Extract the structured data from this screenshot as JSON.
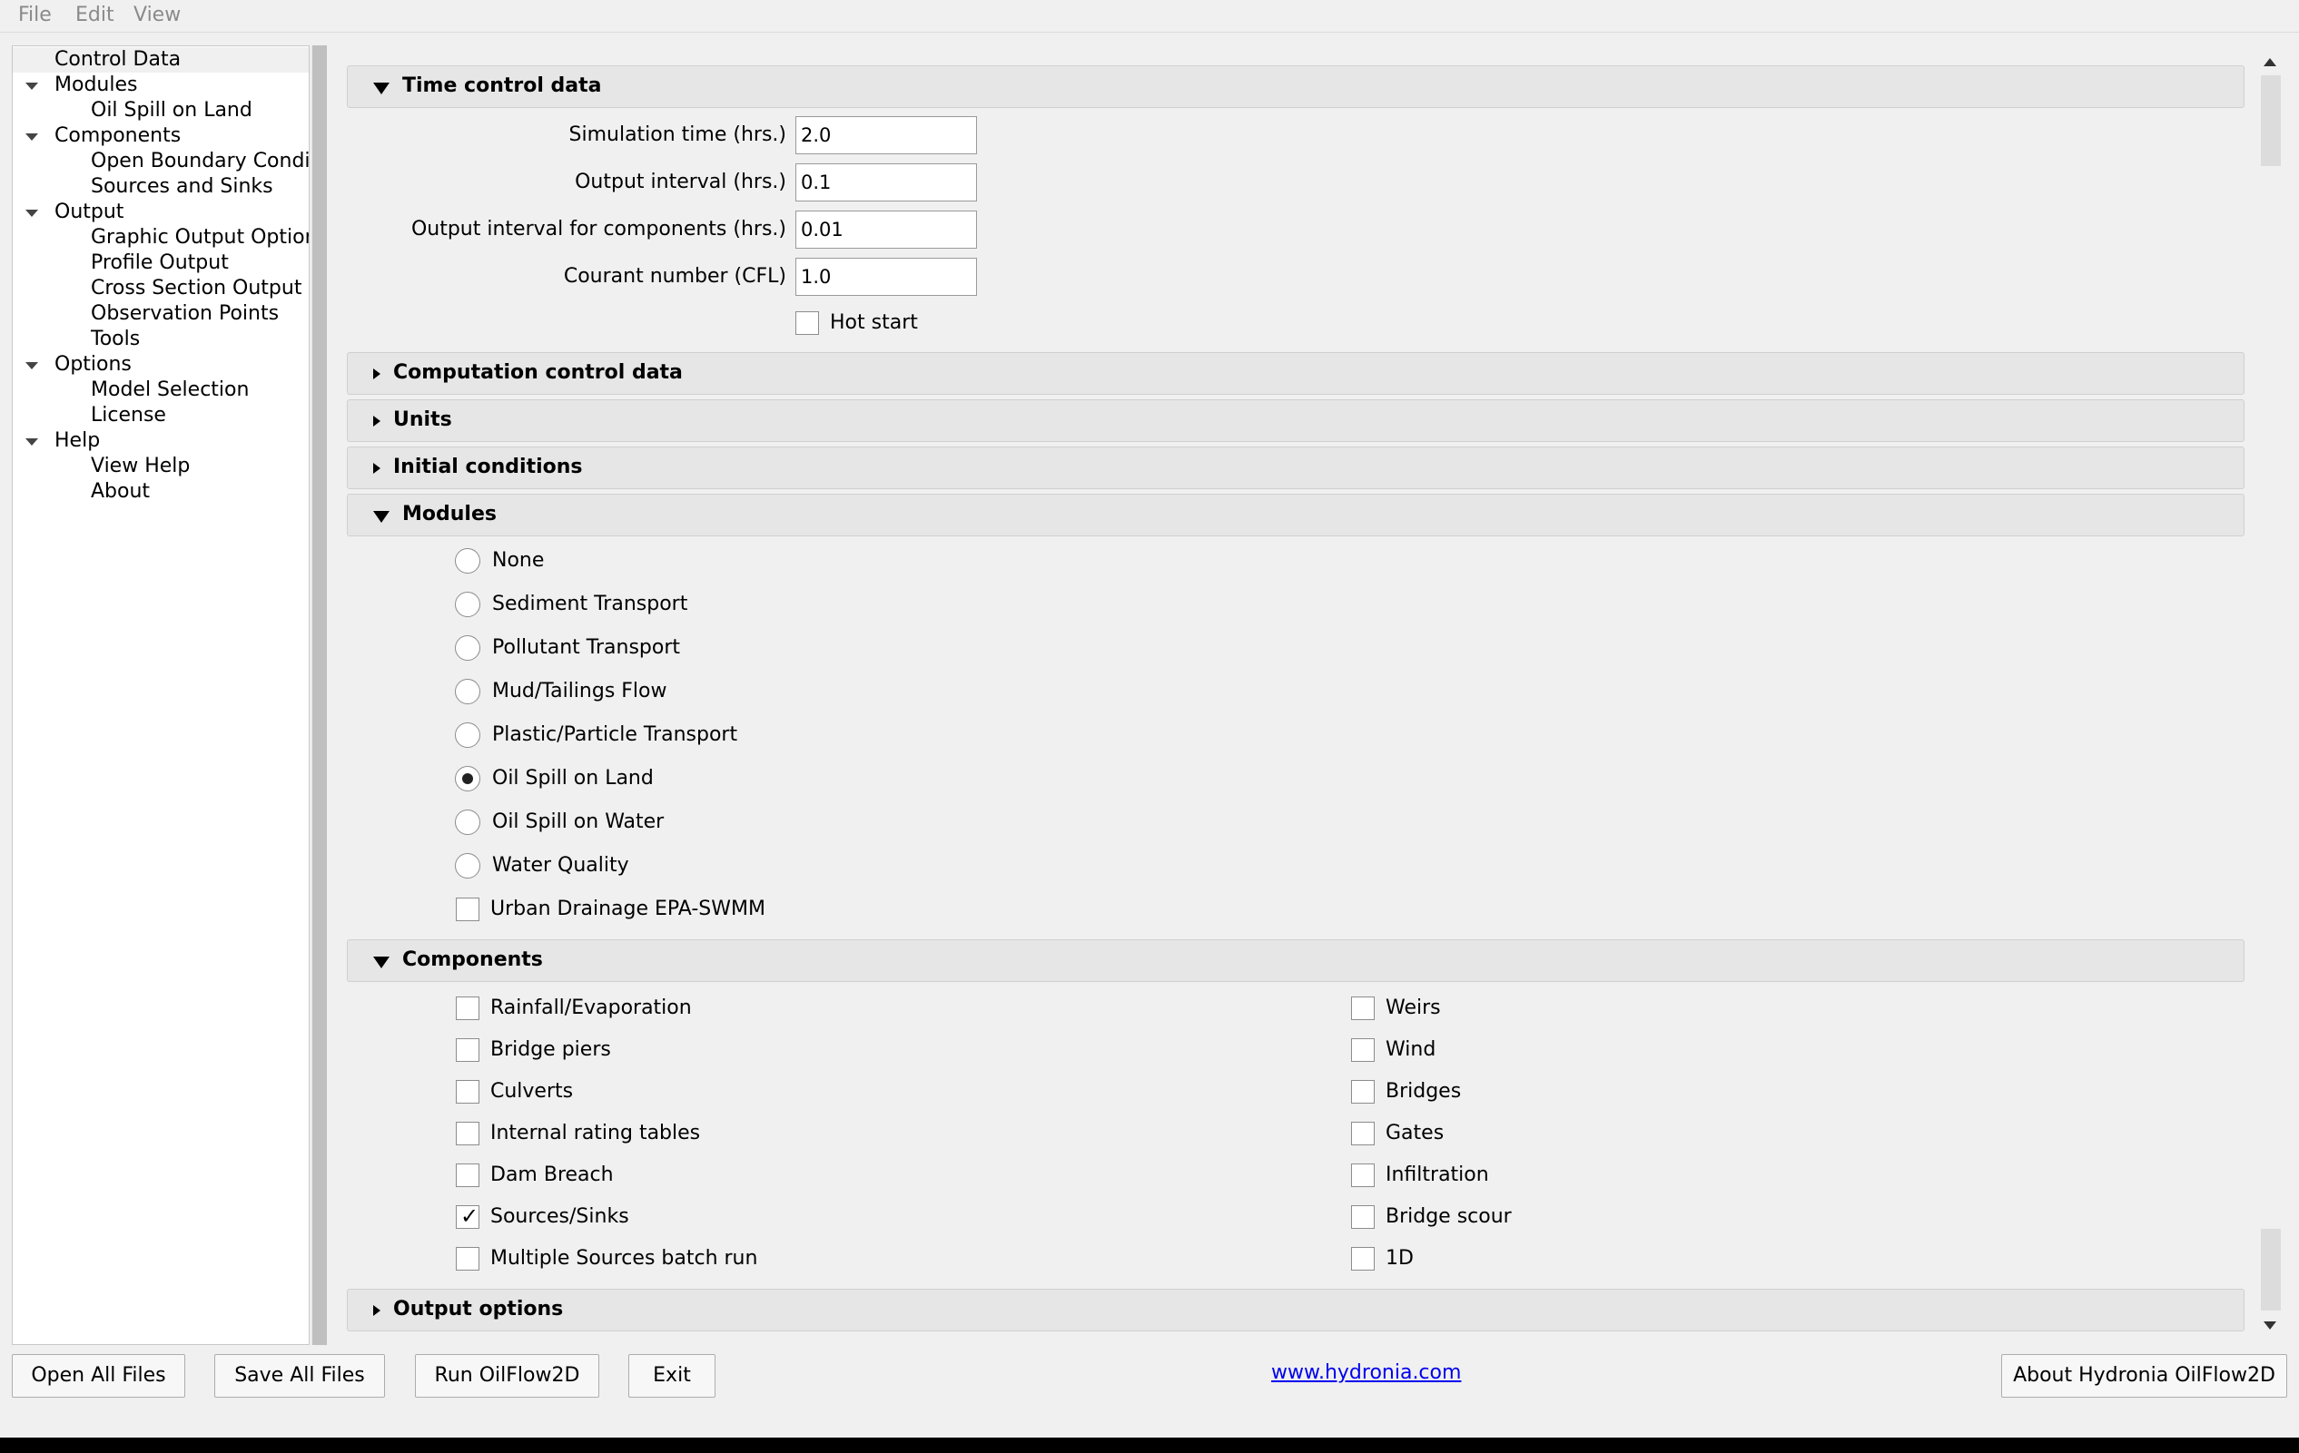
{
  "menu": {
    "file": "File",
    "edit": "Edit",
    "view": "View"
  },
  "tree": {
    "control_data": "Control Data",
    "modules": "Modules",
    "oil_spill_on_land": "Oil Spill on Land",
    "components": "Components",
    "open_boundary": "Open Boundary Condi...",
    "sources_and_sinks": "Sources and Sinks",
    "output": "Output",
    "graphic_output_options": "Graphic Output Options",
    "profile_output": "Profile Output",
    "cross_section_output": "Cross Section Output",
    "observation_points": "Observation Points",
    "tools": "Tools",
    "options": "Options",
    "model_selection": "Model Selection",
    "license": "License",
    "help": "Help",
    "view_help": "View Help",
    "about": "About"
  },
  "time_control": {
    "title": "Time control data",
    "simulation_time_label": "Simulation time (hrs.)",
    "simulation_time_value": "2.0",
    "output_interval_label": "Output interval (hrs.)",
    "output_interval_value": "0.1",
    "output_interval_components_label": "Output interval for components (hrs.)",
    "output_interval_components_value": "0.01",
    "courant_label": "Courant number (CFL)",
    "courant_value": "1.0",
    "hot_start_label": "Hot start",
    "hot_start_checked": false
  },
  "sections": {
    "computation_control": "Computation control data",
    "units": "Units",
    "initial_conditions": "Initial conditions",
    "modules": "Modules",
    "components": "Components",
    "output_options": "Output options"
  },
  "modules": {
    "options": [
      "None",
      "Sediment Transport",
      "Pollutant Transport",
      "Mud/Tailings Flow",
      "Plastic/Particle Transport",
      "Oil Spill on Land",
      "Oil Spill on Water",
      "Water Quality"
    ],
    "selected": "Oil Spill on Land",
    "urban_drainage_label": "Urban Drainage EPA-SWMM",
    "urban_drainage_checked": false
  },
  "components": {
    "left": [
      {
        "label": "Rainfall/Evaporation",
        "checked": false
      },
      {
        "label": "Bridge piers",
        "checked": false
      },
      {
        "label": "Culverts",
        "checked": false
      },
      {
        "label": "Internal rating tables",
        "checked": false
      },
      {
        "label": "Dam Breach",
        "checked": false
      },
      {
        "label": "Sources/Sinks",
        "checked": true
      },
      {
        "label": "Multiple Sources batch run",
        "checked": false
      }
    ],
    "right": [
      {
        "label": "Weirs",
        "checked": false
      },
      {
        "label": "Wind",
        "checked": false
      },
      {
        "label": "Bridges",
        "checked": false
      },
      {
        "label": "Gates",
        "checked": false
      },
      {
        "label": "Infiltration",
        "checked": false
      },
      {
        "label": "Bridge scour",
        "checked": false
      },
      {
        "label": "1D",
        "checked": false
      }
    ]
  },
  "buttons": {
    "open_all": "Open All Files",
    "save_all": "Save All Files",
    "run": "Run OilFlow2D",
    "exit": "Exit",
    "about": "About Hydronia OilFlow2D"
  },
  "link": "www.hydronia.com",
  "check_glyph": "✓"
}
